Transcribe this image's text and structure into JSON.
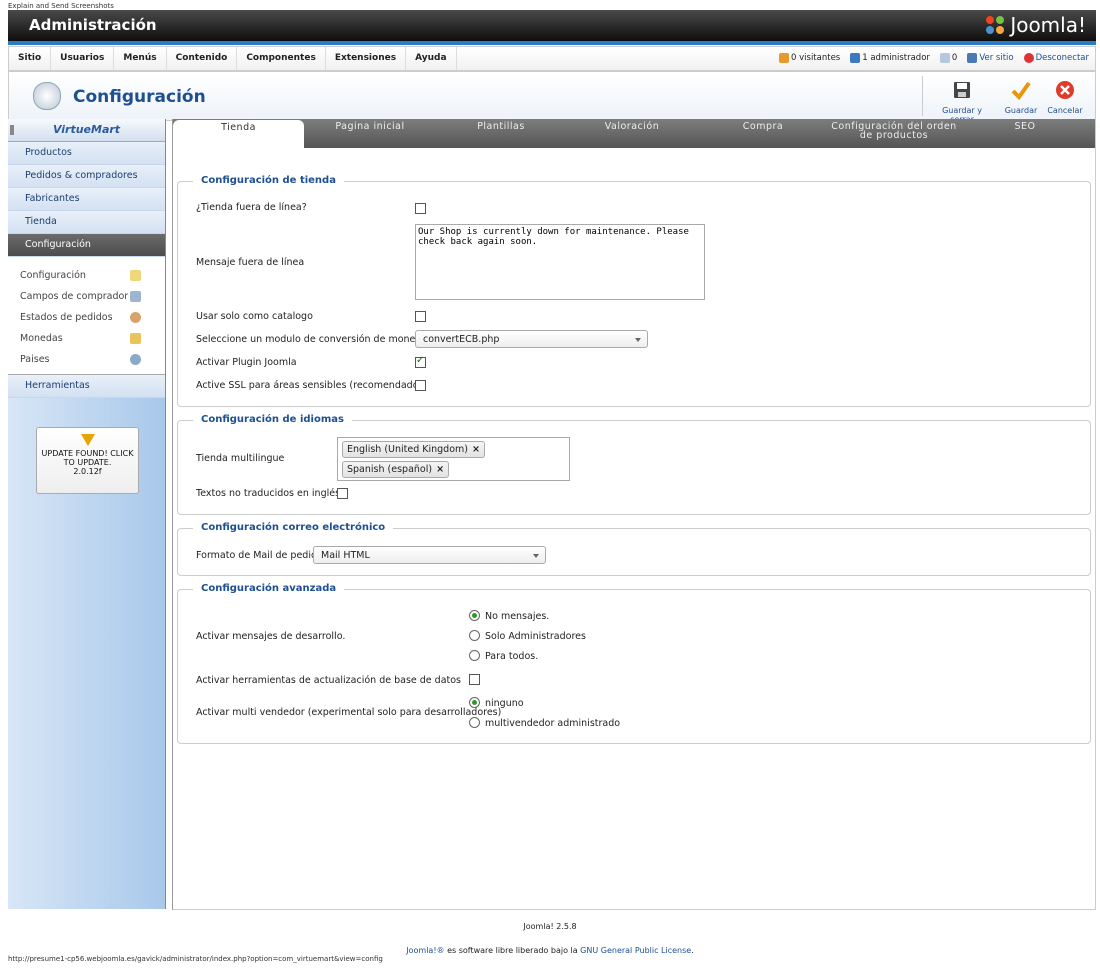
{
  "top_caption": "Explain and Send Screenshots",
  "header": {
    "title": "Administración",
    "logo_text": "Joomla!",
    "accent": "#2a7cc7"
  },
  "menu": {
    "items": [
      "Sitio",
      "Usuarios",
      "Menús",
      "Contenido",
      "Componentes",
      "Extensiones",
      "Ayuda"
    ],
    "visitors": "0 visitantes",
    "admins": "1 administrador",
    "messages": "0",
    "view_site": "Ver sitio",
    "logout": "Desconectar"
  },
  "toolbar": {
    "title": "Configuración",
    "save_close": "Guardar y cerrar",
    "save": "Guardar",
    "cancel": "Cancelar"
  },
  "sidebar": {
    "logo": "VirtueMart",
    "items": [
      "Productos",
      "Pedidos & compradores",
      "Fabricantes",
      "Tienda",
      "Configuración"
    ],
    "subitems": [
      "Configuración",
      "Campos de comprador",
      "Estados de pedidos",
      "Monedas",
      "Paises"
    ],
    "tools": "Herramientas",
    "update": {
      "line1": "UPDATE FOUND! CLICK",
      "line2": "TO UPDATE.",
      "version": "2.0.12f"
    }
  },
  "tabs": [
    "Tienda",
    "Pagina inicial",
    "Plantillas",
    "Valoración",
    "Compra",
    "Configuración del orden de productos",
    "SEO"
  ],
  "shop": {
    "legend": "Configuración de tienda",
    "offline_label": "¿Tienda fuera de línea?",
    "offline_msg_label": "Mensaje fuera de línea",
    "offline_msg": "Our Shop is currently down for maintenance. Please check back again soon.",
    "catalog_label": "Usar solo como catalogo",
    "currency_label": "Seleccione un modulo de conversión de moneda",
    "currency_value": "convertECB.php",
    "plugin_label": "Activar Plugin Joomla",
    "ssl_label": "Active SSL para áreas sensibles (recomendado)"
  },
  "lang": {
    "legend": "Configuración de idiomas",
    "multi_label": "Tienda multilingue",
    "chips": [
      "English (United Kingdom)",
      "Spanish (español)"
    ],
    "untranslated_label": "Textos no traducidos en inglés"
  },
  "mail": {
    "legend": "Configuración correo electrónico",
    "format_label": "Formato de Mail de pedido",
    "format_value": "Mail HTML"
  },
  "adv": {
    "legend": "Configuración avanzada",
    "dev_label": "Activar mensajes de desarrollo.",
    "dev_options": [
      "No mensajes.",
      "Solo Administradores",
      "Para todos."
    ],
    "db_label": "Activar herramientas de actualización de base de datos",
    "vendor_label": "Activar multi vendedor (experimental solo para desarrolladores)",
    "vendor_options": [
      "ninguno",
      "multivendedor administrado"
    ]
  },
  "footer": {
    "version": "Joomla! 2.5.8",
    "license_pre": "Joomla!®",
    "license_mid": " es software libre liberado bajo la ",
    "license_link": "GNU General Public License",
    "license_end": "."
  },
  "status_url": "http://presume1-cp56.webjoomla.es/gavick/administrator/index.php?option=com_virtuemart&view=config"
}
